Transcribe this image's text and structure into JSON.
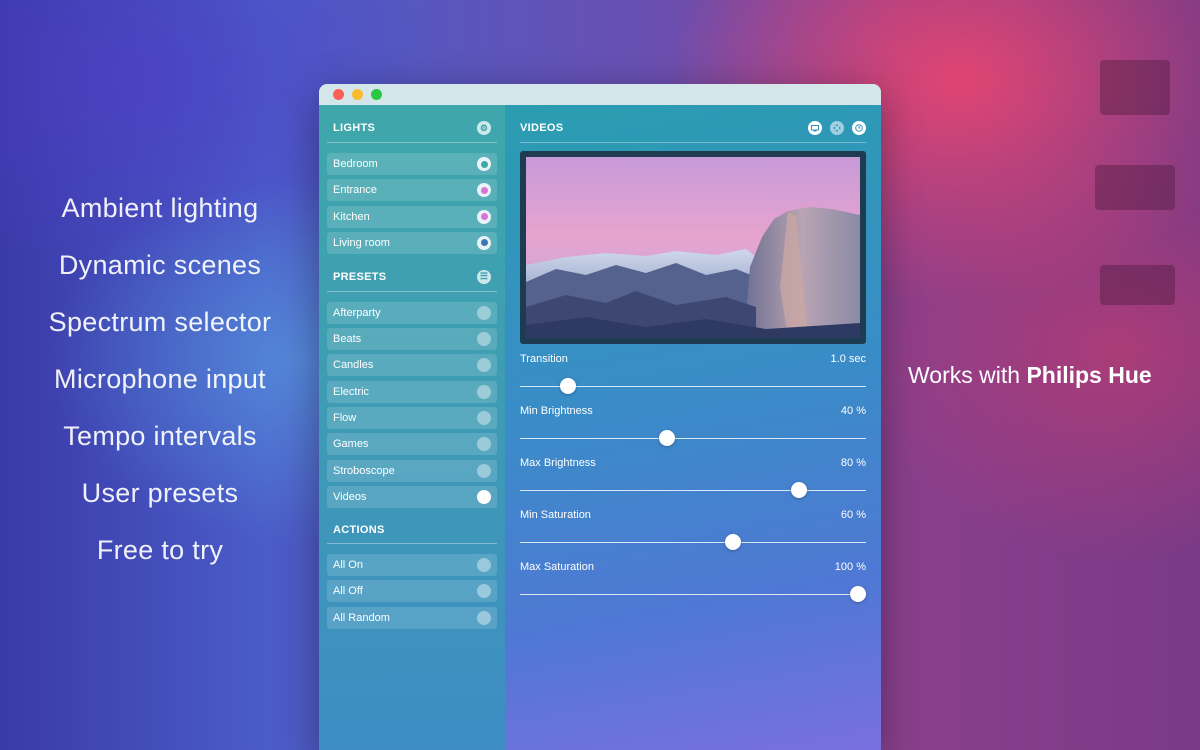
{
  "features": [
    "Ambient lighting",
    "Dynamic scenes",
    "Spectrum selector",
    "Microphone input",
    "Tempo intervals",
    "User presets",
    "Free to try"
  ],
  "works_with": {
    "prefix": "Works with",
    "brand": "Philips Hue"
  },
  "sidebar": {
    "lights": {
      "title": "LIGHTS",
      "icon": "gear-icon",
      "items": [
        {
          "label": "Bedroom",
          "color": "#3ea8a4"
        },
        {
          "label": "Entrance",
          "color": "#d874d6"
        },
        {
          "label": "Kitchen",
          "color": "#d874d6"
        },
        {
          "label": "Living room",
          "color": "#3c78b4"
        }
      ]
    },
    "presets": {
      "title": "PRESETS",
      "icon": "list-icon",
      "items": [
        {
          "label": "Afterparty",
          "selected": false
        },
        {
          "label": "Beats",
          "selected": false
        },
        {
          "label": "Candles",
          "selected": false
        },
        {
          "label": "Electric",
          "selected": false
        },
        {
          "label": "Flow",
          "selected": false
        },
        {
          "label": "Games",
          "selected": false
        },
        {
          "label": "Stroboscope",
          "selected": false
        },
        {
          "label": "Videos",
          "selected": true
        }
      ]
    },
    "actions": {
      "title": "ACTIONS",
      "items": [
        {
          "label": "All On"
        },
        {
          "label": "All Off"
        },
        {
          "label": "All Random"
        }
      ]
    }
  },
  "main": {
    "title": "VIDEOS",
    "icons": [
      "screen-icon",
      "move-icon",
      "clock-icon"
    ],
    "sliders": [
      {
        "label": "Transition",
        "value": "1.0 sec",
        "level": 0.12
      },
      {
        "label": "Min Brightness",
        "value": "40 %",
        "level": 0.42
      },
      {
        "label": "Max Brightness",
        "value": "80 %",
        "level": 0.82
      },
      {
        "label": "Min Saturation",
        "value": "60 %",
        "level": 0.62
      },
      {
        "label": "Max Saturation",
        "value": "100 %",
        "level": 1.0
      }
    ]
  },
  "colors": {
    "accent_teal": "#3ea8a4",
    "accent_pink": "#d874d6",
    "accent_blue": "#3c78b4"
  }
}
